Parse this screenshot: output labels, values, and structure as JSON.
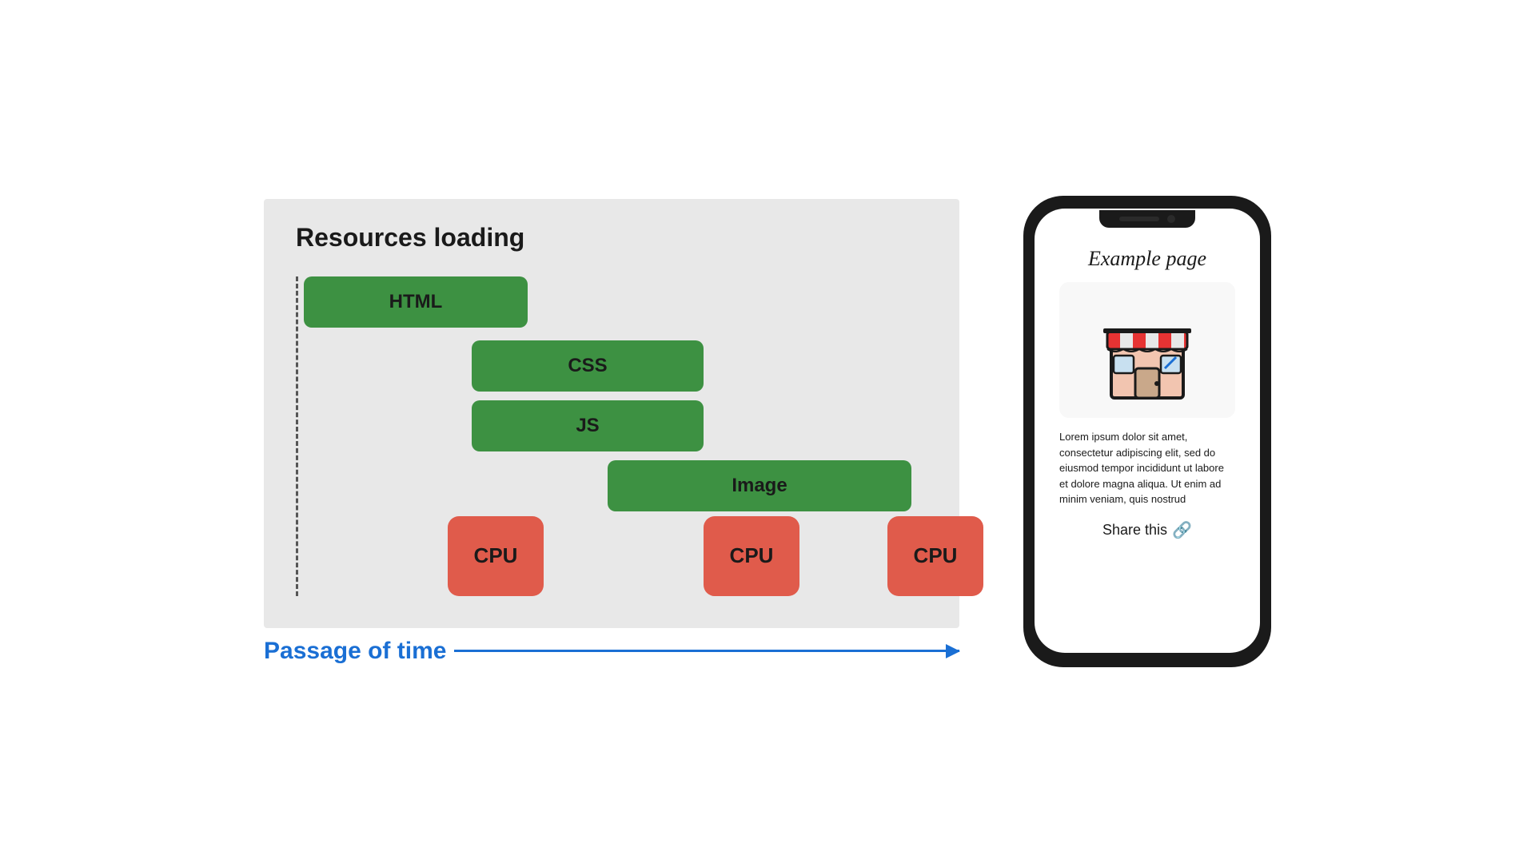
{
  "diagram": {
    "title": "Resources loading",
    "bars": [
      {
        "label": "HTML"
      },
      {
        "label": "CSS"
      },
      {
        "label": "JS"
      },
      {
        "label": "Image"
      }
    ],
    "cpu_labels": [
      "CPU",
      "CPU",
      "CPU"
    ],
    "time_label": "Passage of time"
  },
  "phone": {
    "page_title": "Example page",
    "lorem_text": "Lorem ipsum dolor sit amet, consectetur adipiscing elit, sed do eiusmod tempor incididunt ut labore et dolore magna aliqua. Ut enim ad minim veniam, quis nostrud",
    "share_label": "Share this"
  }
}
